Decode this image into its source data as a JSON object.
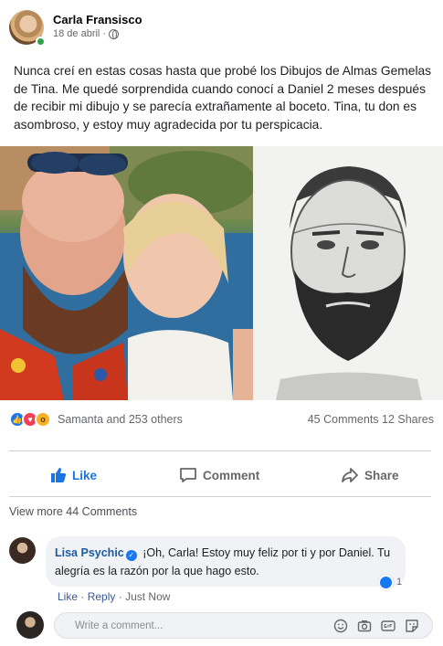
{
  "post": {
    "author": "Carla Fransisco",
    "date": "18 de abril",
    "separator": "·",
    "text": "Nunca creí en estas cosas hasta que probé los Dibujos de Almas Gemelas de Tina. Me quedé sorprendida cuando conocí a Daniel 2 meses después de recibir mi dibujo y se parecía extrañamente al boceto. Tina, tu don es asombroso, y estoy muy agradecida por tu perspicacia."
  },
  "reactions": {
    "summary": "Samanta and 253 others",
    "counts": "45 Comments 12 Shares",
    "types": [
      "like-icon",
      "love-icon",
      "wow-icon"
    ]
  },
  "actions": {
    "like": "Like",
    "comment": "Comment",
    "share": "Share"
  },
  "comments": {
    "view_more": "View more 44 Comments",
    "items": [
      {
        "author": "Lisa Psychic",
        "text": "¡Oh, Carla! Estoy muy feliz por ti y por Daniel. Tu alegría es la razón por la que hago esto.",
        "reaction_count": "1",
        "like_link": "Like",
        "reply_link": "Reply",
        "time": "Just Now"
      }
    ],
    "input_placeholder": "Write a comment..."
  },
  "colors": {
    "accent": "#1b74e4",
    "name_link": "#1b5b9c",
    "muted": "#65676b",
    "online": "#31a24c"
  }
}
